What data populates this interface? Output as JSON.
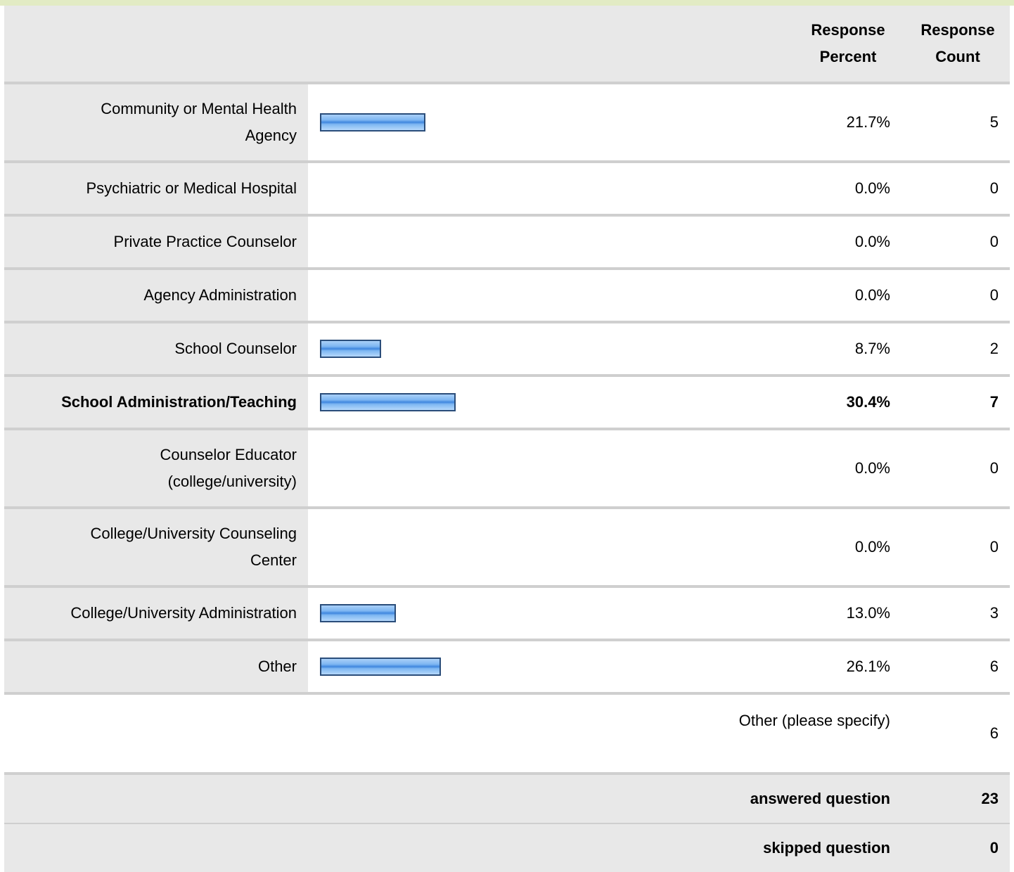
{
  "header": {
    "percent_label": "Response Percent",
    "count_label": "Response Count"
  },
  "chart_data": {
    "type": "bar",
    "categories": [
      "Community or Mental Health Agency",
      "Psychiatric or Medical Hospital",
      "Private Practice Counselor",
      "Agency Administration",
      "School Counselor",
      "School Administration/Teaching",
      "Counselor Educator (college/university)",
      "College/University Counseling Center",
      "College/University Administration",
      "Other"
    ],
    "percent_labels": [
      "21.7%",
      "0.0%",
      "0.0%",
      "0.0%",
      "8.7%",
      "30.4%",
      "0.0%",
      "0.0%",
      "13.0%",
      "26.1%"
    ],
    "values": [
      21.7,
      0.0,
      0.0,
      0.0,
      8.7,
      30.4,
      0.0,
      0.0,
      13.0,
      26.1
    ],
    "counts": [
      "5",
      "0",
      "0",
      "0",
      "2",
      "7",
      "0",
      "0",
      "3",
      "6"
    ],
    "highlighted_index": 5,
    "bar_color": "#5fa3ea",
    "bar_border": "#2a4d7a"
  },
  "other_specify": {
    "label": "Other (please specify)",
    "count": "6"
  },
  "summary": {
    "answered_label": "answered question",
    "answered_value": "23",
    "skipped_label": "skipped question",
    "skipped_value": "0"
  }
}
